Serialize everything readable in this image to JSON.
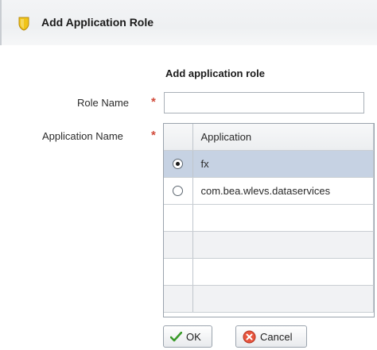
{
  "dialog": {
    "title": "Add Application Role",
    "icon": "shield-icon",
    "accent": "#f0c419"
  },
  "form": {
    "section_title": "Add application role",
    "role_name": {
      "label": "Role Name",
      "value": "",
      "placeholder": ""
    },
    "application_name": {
      "label": "Application Name"
    },
    "required_marker": "*",
    "required_color": "#d14a3a"
  },
  "table": {
    "header": "Application",
    "rows": [
      {
        "label": "fx",
        "selected": true
      },
      {
        "label": "com.bea.wlevs.dataservices",
        "selected": false
      },
      {
        "label": ""
      },
      {
        "label": ""
      },
      {
        "label": ""
      },
      {
        "label": ""
      }
    ],
    "selected_row_color": "#c6d2e3"
  },
  "buttons": {
    "ok": {
      "label": "OK",
      "icon": "check-icon"
    },
    "cancel": {
      "label": "Cancel",
      "icon": "cancel-icon"
    }
  }
}
